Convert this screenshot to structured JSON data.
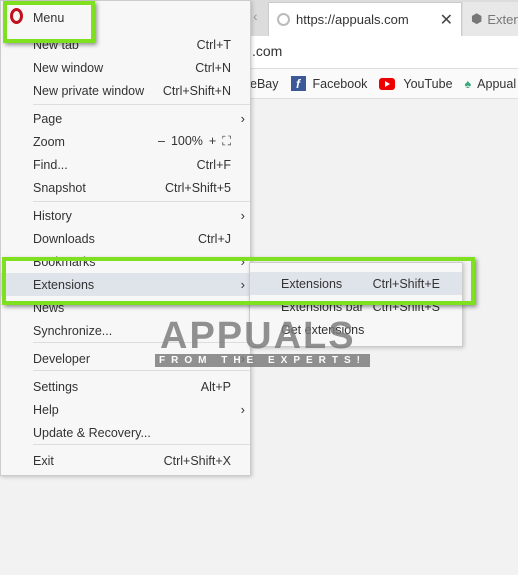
{
  "browser": {
    "tab_active": "https://appuals.com",
    "tab_other": "Extens",
    "address": ".com",
    "bookmarks": [
      "eBay",
      "Facebook",
      "YouTube",
      "Appual"
    ]
  },
  "menu": {
    "title": "Menu",
    "items": [
      {
        "label": "New tab",
        "shortcut": "Ctrl+T"
      },
      {
        "label": "New window",
        "shortcut": "Ctrl+N"
      },
      {
        "label": "New private window",
        "shortcut": "Ctrl+Shift+N"
      },
      {
        "label": "Page",
        "shortcut": ""
      },
      {
        "label": "Zoom",
        "shortcut": ""
      },
      {
        "label": "Find...",
        "shortcut": "Ctrl+F"
      },
      {
        "label": "Snapshot",
        "shortcut": "Ctrl+Shift+5"
      },
      {
        "label": "History",
        "shortcut": ""
      },
      {
        "label": "Downloads",
        "shortcut": "Ctrl+J"
      },
      {
        "label": "Bookmarks",
        "shortcut": ""
      },
      {
        "label": "Extensions",
        "shortcut": ""
      },
      {
        "label": "News",
        "shortcut": ""
      },
      {
        "label": "Synchronize...",
        "shortcut": ""
      },
      {
        "label": "Developer",
        "shortcut": ""
      },
      {
        "label": "Settings",
        "shortcut": "Alt+P"
      },
      {
        "label": "Help",
        "shortcut": ""
      },
      {
        "label": "Update & Recovery...",
        "shortcut": ""
      },
      {
        "label": "Exit",
        "shortcut": "Ctrl+Shift+X"
      }
    ],
    "zoom": {
      "minus": "–",
      "value": "100%",
      "plus": "+",
      "fullscreen": "⛶"
    }
  },
  "submenu": {
    "items": [
      {
        "label": "Extensions",
        "shortcut": "Ctrl+Shift+E"
      },
      {
        "label": "Extensions bar",
        "shortcut": "Ctrl+Shift+S"
      },
      {
        "label": "Get extensions",
        "shortcut": ""
      }
    ]
  },
  "watermark": {
    "text": "APPUALS",
    "tagline": "FROM THE EXPERTS!"
  },
  "colors": {
    "highlight": "#7ee01e",
    "opera": "#c0121c"
  }
}
